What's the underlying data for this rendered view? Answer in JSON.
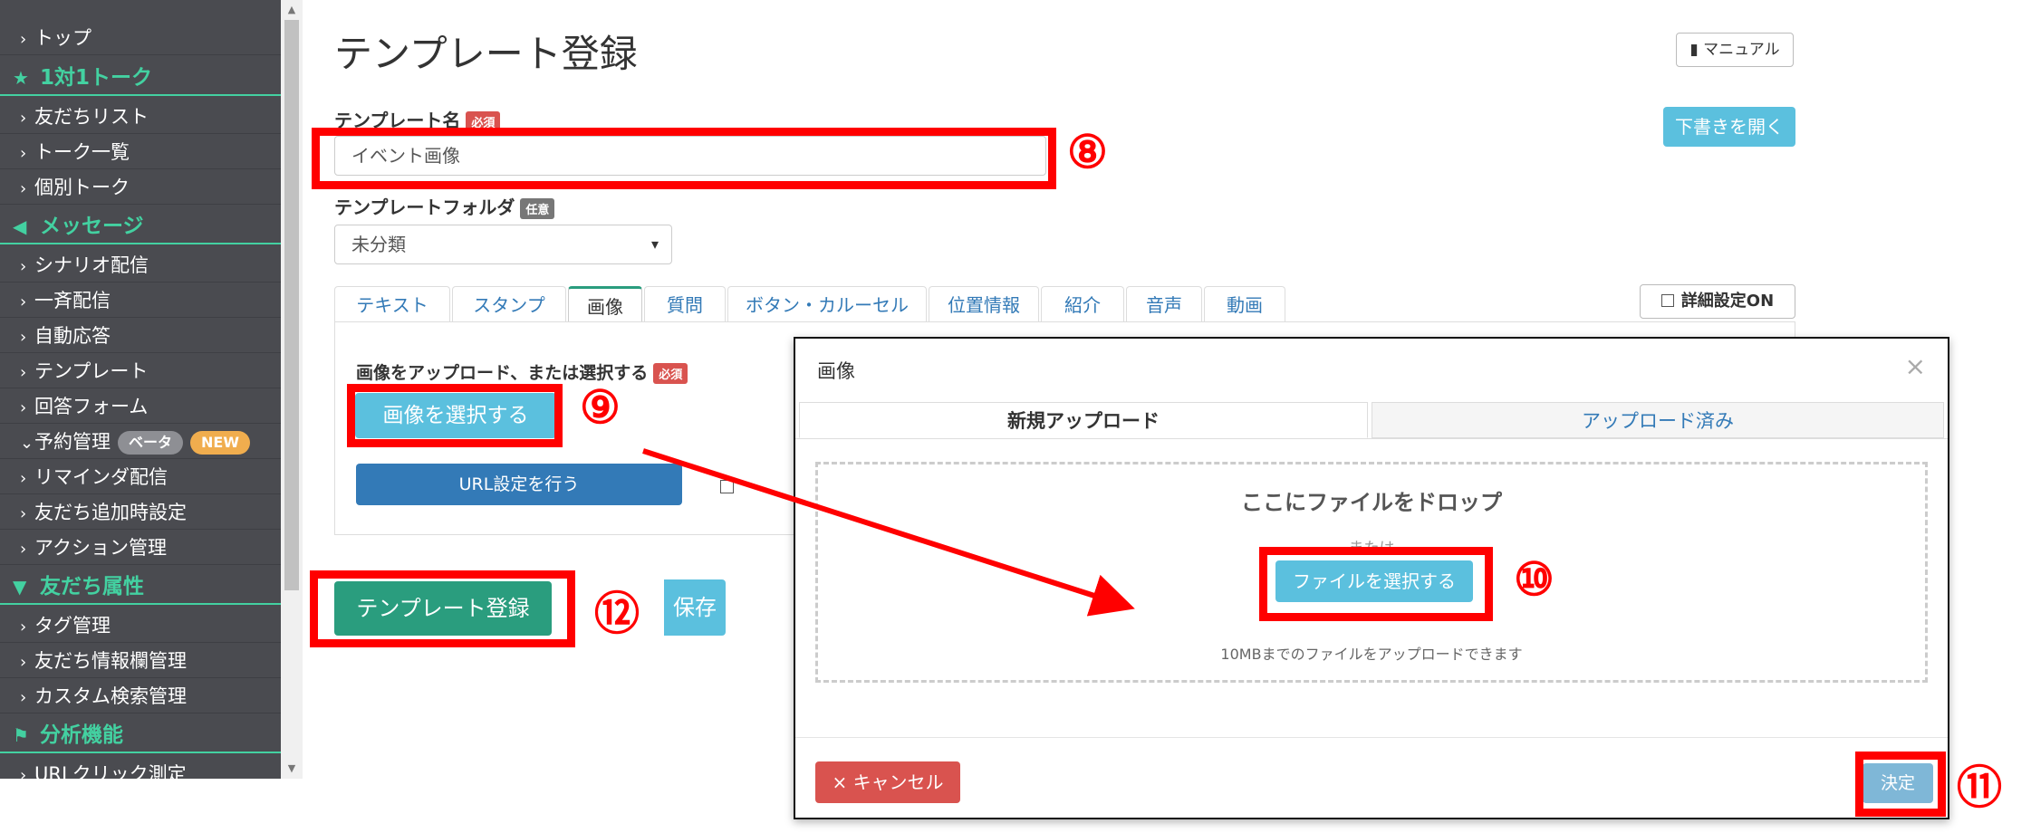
{
  "sidebar": {
    "top": "トップ",
    "sections": [
      {
        "title": "1対1トーク",
        "items": [
          "友だちリスト",
          "トーク一覧",
          "個別トーク"
        ]
      },
      {
        "title": "メッセージ",
        "items": [
          "シナリオ配信",
          "一斉配信",
          "自動応答",
          "テンプレート",
          "回答フォーム",
          "予約管理",
          "リマインダ配信",
          "友だち追加時設定",
          "アクション管理"
        ]
      },
      {
        "title": "友だち属性",
        "items": [
          "タグ管理",
          "友だち情報欄管理",
          "カスタム検索管理"
        ]
      },
      {
        "title": "分析機能",
        "items": [
          "URLクリック測定"
        ]
      }
    ],
    "badge_beta": "ベータ",
    "badge_new": "NEW"
  },
  "page": {
    "title": "テンプレート登録",
    "manual_button": "マニュアル",
    "draft_button": "下書きを開く",
    "template_name_label": "テンプレート名",
    "required_badge": "必須",
    "template_name_value": "イベント画像",
    "folder_label": "テンプレートフォルダ",
    "optional_badge": "任意",
    "folder_selected": "未分類",
    "tabs": [
      "テキスト",
      "スタンプ",
      "画像",
      "質問",
      "ボタン・カルーセル",
      "位置情報",
      "紹介",
      "音声",
      "動画"
    ],
    "detail_setting_label": "詳細設定ON",
    "upload_label": "画像をアップロード、または選択する",
    "select_image_button": "画像を選択する",
    "url_setting_button": "URL設定を行う",
    "register_button": "テンプレート登録",
    "save_button": "保存"
  },
  "modal": {
    "title": "画像",
    "close": "×",
    "tab_new": "新規アップロード",
    "tab_uploaded": "アップロード済み",
    "drop_text": "ここにファイルをドロップ",
    "or_text": "または",
    "select_file_button": "ファイルを選択する",
    "limit_text": "10MBまでのファイルをアップロードできます",
    "cancel_button": "キャンセル",
    "cancel_icon": "×",
    "ok_button": "決定"
  },
  "annotations": [
    "⑧",
    "⑨",
    "⑩",
    "⑪",
    "⑫"
  ],
  "colors": {
    "sidebar_bg": "#4a4b50",
    "accent_green": "#43d1a1",
    "primary_green": "#2a9d7e",
    "info_blue": "#5bc0de",
    "primary_blue": "#337ab7",
    "danger_red": "#d9534f",
    "annotation_red": "#ff0000"
  }
}
